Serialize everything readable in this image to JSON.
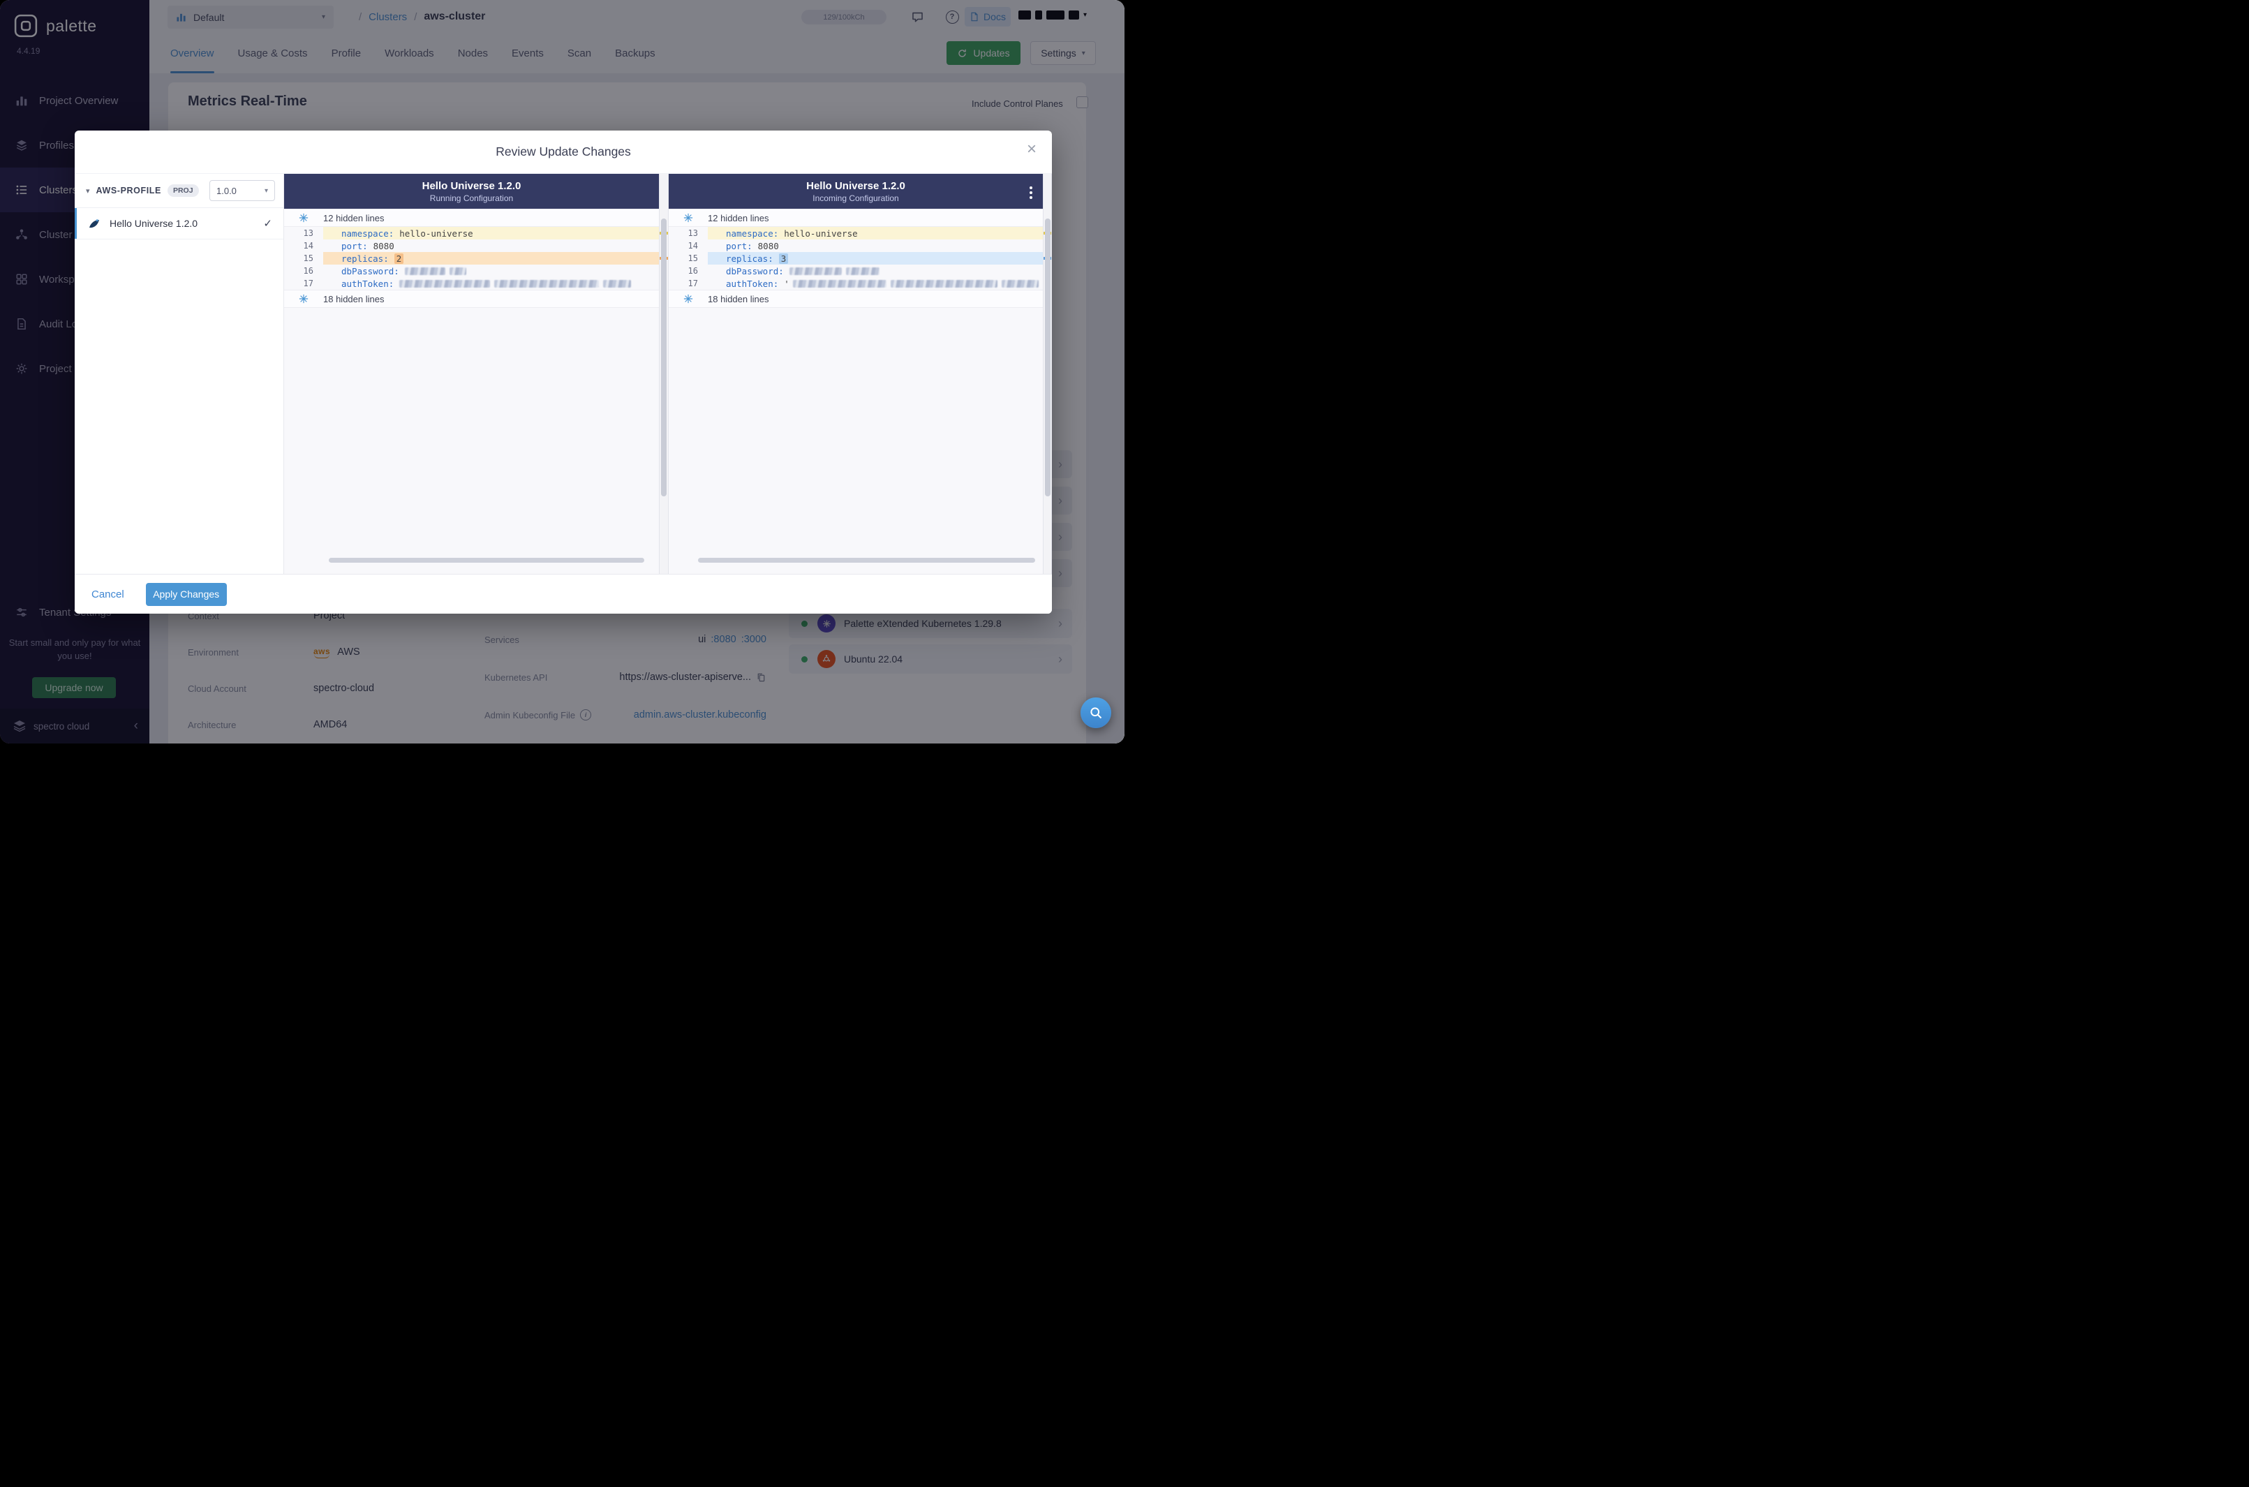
{
  "sidebar": {
    "brand": "palette",
    "version": "4.4.19",
    "items": [
      {
        "label": "Project Overview"
      },
      {
        "label": "Profiles"
      },
      {
        "label": "Clusters"
      },
      {
        "label": "Cluster Groups"
      },
      {
        "label": "Workspaces"
      },
      {
        "label": "Audit Logs"
      },
      {
        "label": "Project Settings"
      },
      {
        "label": "Tenant Settings"
      }
    ],
    "promo_text": "Start small and only pay for what you use!",
    "upgrade_label": "Upgrade now",
    "footer_brand": "spectro cloud"
  },
  "header": {
    "project_selector": "Default",
    "separator": "/",
    "breadcrumb": [
      "Clusters",
      "aws-cluster"
    ],
    "usage_badge": "129/100kCh",
    "docs_label": "Docs"
  },
  "tabs": {
    "items": [
      "Overview",
      "Usage & Costs",
      "Profile",
      "Workloads",
      "Nodes",
      "Events",
      "Scan",
      "Backups"
    ],
    "active": "Overview",
    "updates_label": "Updates",
    "settings_label": "Settings"
  },
  "content": {
    "metrics_title": "Metrics Real-Time",
    "include_control_planes": "Include Control Planes",
    "details": [
      {
        "label": "Context",
        "value": "Project"
      },
      {
        "label": "Environment",
        "value": "AWS"
      },
      {
        "label": "Cloud Account",
        "value": "spectro-cloud"
      },
      {
        "label": "Architecture",
        "value": "AMD64"
      }
    ],
    "services_label": "Services",
    "services_value": "ui",
    "services_ports": [
      ":8080",
      ":3000"
    ],
    "k8s_api_label": "Kubernetes API",
    "k8s_api_value": "https://aws-cluster-apiserve...",
    "kubeconfig_label": "Admin Kubeconfig File",
    "kubeconfig_value": "admin.aws-cluster.kubeconfig",
    "packs": [
      {
        "name": "Palette eXtended Kubernetes 1.29.8"
      },
      {
        "name": "Ubuntu 22.04"
      }
    ]
  },
  "modal": {
    "title": "Review Update Changes",
    "profile_name": "AWS-PROFILE",
    "profile_scope": "PROJ",
    "profile_version": "1.0.0",
    "pack_name": "Hello Universe 1.2.0",
    "left_panel": {
      "title": "Hello Universe 1.2.0",
      "subtitle": "Running Configuration"
    },
    "right_panel": {
      "title": "Hello Universe 1.2.0",
      "subtitle": "Incoming Configuration"
    },
    "hidden_top": "12 hidden lines",
    "hidden_bottom": "18 hidden lines",
    "left_lines": [
      {
        "no": "13",
        "key": "namespace:",
        "value": "hello-universe"
      },
      {
        "no": "14",
        "key": "port:",
        "value": "8080"
      },
      {
        "no": "15",
        "key": "replicas:",
        "value": "2"
      },
      {
        "no": "16",
        "key": "dbPassword:",
        "value": ""
      },
      {
        "no": "17",
        "key": "authToken:",
        "value": ""
      }
    ],
    "right_lines": [
      {
        "no": "13",
        "key": "namespace:",
        "value": "hello-universe"
      },
      {
        "no": "14",
        "key": "port:",
        "value": "8080"
      },
      {
        "no": "15",
        "key": "replicas:",
        "value": "3"
      },
      {
        "no": "16",
        "key": "dbPassword:",
        "value": ""
      },
      {
        "no": "17",
        "key": "authToken:",
        "value": "'"
      }
    ],
    "cancel_label": "Cancel",
    "apply_label": "Apply Changes"
  },
  "colors": {
    "accent_blue": "#4a96d4",
    "updates_green": "#3fa45f",
    "diff_header_navy": "#343a63",
    "changed_line_yellow": "#fbf4d5",
    "old_value_orange": "#fce3c2",
    "new_value_blue": "#d8e9fa",
    "sidebar_bg": "#181330"
  }
}
